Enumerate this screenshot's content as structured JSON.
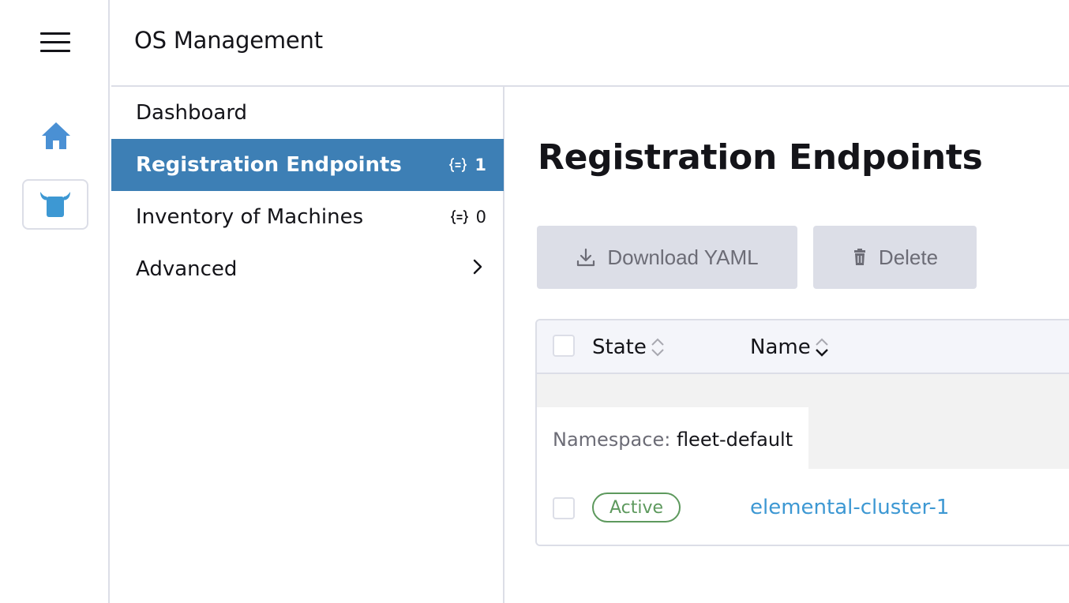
{
  "header": {
    "title": "OS Management"
  },
  "rail": {
    "menu_icon": "hamburger-menu-icon",
    "home_icon": "home-icon",
    "app_icon": "elemental-bull-icon"
  },
  "nav": {
    "items": [
      {
        "label": "Dashboard"
      },
      {
        "label": "Registration Endpoints",
        "count": "1",
        "active": true
      },
      {
        "label": "Inventory of Machines",
        "count": "0"
      },
      {
        "label": "Advanced",
        "icon": "chevron-right-icon"
      }
    ]
  },
  "main": {
    "title": "Registration Endpoints",
    "buttons": {
      "download_label": "Download YAML",
      "delete_label": "Delete"
    },
    "table": {
      "columns": [
        "State",
        "Name"
      ],
      "group": {
        "prefix": "Namespace:",
        "value": "fleet-default"
      },
      "rows": [
        {
          "state": "Active",
          "name": "elemental-cluster-1"
        }
      ]
    }
  },
  "colors": {
    "accent": "#3d7fb5",
    "link": "#3d98d3",
    "success": "#5d995d",
    "border": "#dcdee7",
    "button_bg": "#dcdee7"
  }
}
